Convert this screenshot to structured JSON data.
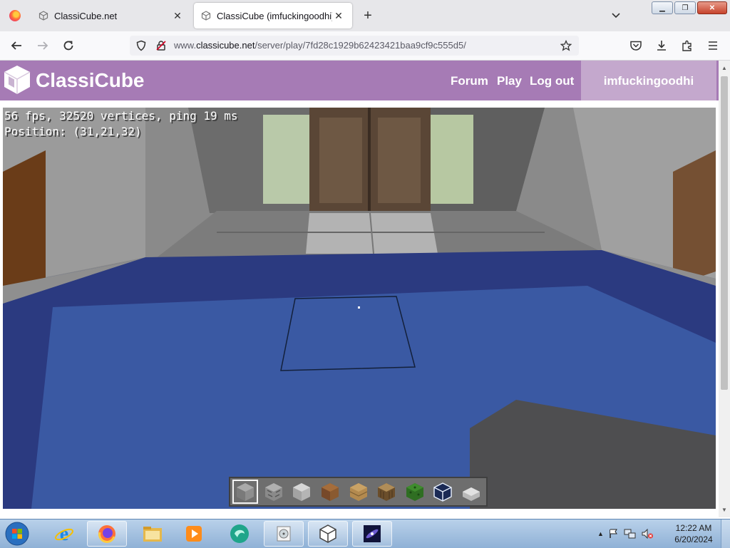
{
  "browser": {
    "tabs": [
      {
        "title": "ClassiCube.net",
        "active": false
      },
      {
        "title": "ClassiCube (imfuckingoodhi)",
        "active": true
      }
    ],
    "url": {
      "prefix": "www.",
      "domain": "classicube.net",
      "path": "/server/play/7fd28c1929b62423421baa9cf9c555d5/"
    },
    "icons": [
      "back-icon",
      "forward-icon",
      "reload-icon",
      "shield-icon",
      "lock-icon",
      "bookmark-star-icon",
      "pocket-icon",
      "download-icon",
      "extensions-icon",
      "menu-icon"
    ]
  },
  "site": {
    "brand": "ClassiCube",
    "nav": [
      {
        "label": "Forum"
      },
      {
        "label": "Play"
      },
      {
        "label": "Log out"
      }
    ],
    "username": "imfuckingoodhi",
    "header_color": "#a67bb5",
    "user_panel_color": "#c4a8cd"
  },
  "game": {
    "hud_line1": "56 fps, 32520 vertices, ping 19 ms",
    "hud_line2": "Position: (31,21,32)",
    "hotbar": {
      "selected_index": 0,
      "slots": [
        "stone",
        "cobblestone",
        "stone-slab",
        "dirt",
        "wood-planks",
        "tree-trunk",
        "leaves",
        "glass",
        "slab"
      ]
    }
  },
  "taskbar": {
    "apps": [
      "internet-explorer",
      "firefox",
      "file-explorer",
      "media-player",
      "mail-app",
      "disc-app",
      "classicube",
      "space-app"
    ],
    "clock_time": "12:22 AM",
    "clock_date": "6/20/2024"
  }
}
